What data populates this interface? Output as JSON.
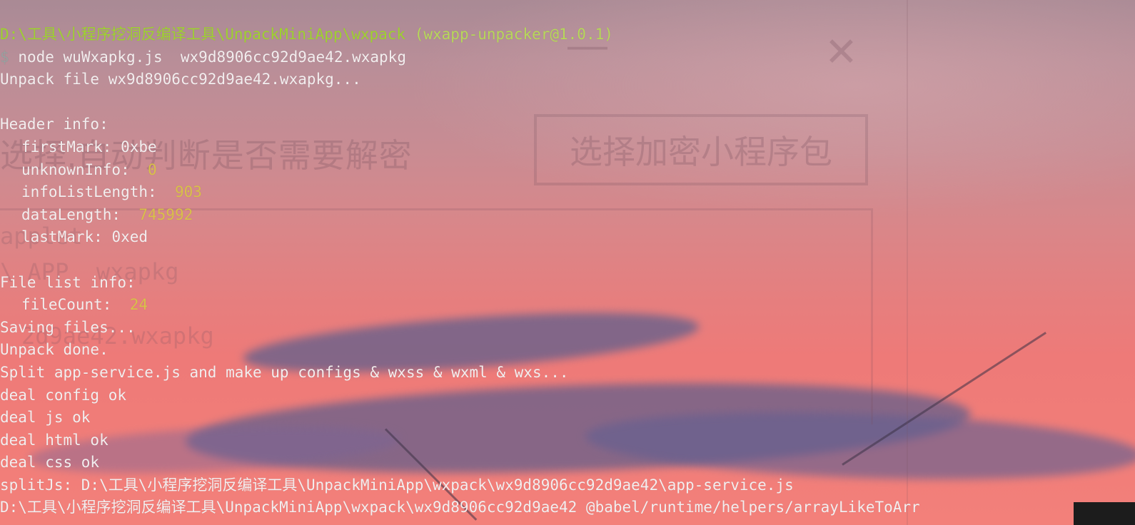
{
  "background_colors": {
    "top": "#a98a95",
    "bottom": "#f3807a",
    "cloud": "#5f5f8c"
  },
  "text_colors": {
    "default": "#f3eeef",
    "prompt_path": "#9fd330",
    "number": "#d9c04a"
  },
  "ghost_window": {
    "label": "选择,自动判断是否需要解密",
    "button": "选择加密小程序包",
    "close_glyph": "✕",
    "minimize_glyph": "—",
    "faint_lines": [
      "applet",
      "\\ APP  wxapkg",
      "2d9ae42.wxapkg"
    ]
  },
  "terminal": {
    "prompt_path": "D:\\工具\\小程序挖洞反编译工具\\UnpackMiniApp\\wxpack",
    "prompt_package": "(wxapp-unpacker@1.0.1)",
    "command_marker": "$",
    "command": "node wuWxapkg.js  wx9d8906cc92d9ae42.wxapkg",
    "unpack_line": "Unpack file wx9d8906cc92d9ae42.wxapkg...",
    "header_title": "Header info:",
    "header": {
      "first_mark_label": "firstMark: ",
      "first_mark_value": "0xbe",
      "unknown_info_label": "unknownInfo:  ",
      "unknown_info_value": "0",
      "info_list_length_label": "infoListLength:  ",
      "info_list_length_value": "903",
      "data_length_label": "dataLength:  ",
      "data_length_value": "745992",
      "last_mark_label": "lastMark: ",
      "last_mark_value": "0xed"
    },
    "file_list_title": "File list info:",
    "file_count_label": "fileCount:  ",
    "file_count_value": "24",
    "saving": "Saving files...",
    "unpack_done": "Unpack done.",
    "split": "Split app-service.js and make up configs & wxss & wxml & wxs...",
    "deal_config": "deal config ok",
    "deal_js": "deal js ok",
    "deal_html": "deal html ok",
    "deal_css": "deal css ok",
    "split_js": "splitJs: D:\\工具\\小程序挖洞反编译工具\\UnpackMiniApp\\wxpack\\wx9d8906cc92d9ae42\\app-service.js",
    "last_line": "D:\\工具\\小程序挖洞反编译工具\\UnpackMiniApp\\wxpack\\wx9d8906cc92d9ae42 @babel/runtime/helpers/arrayLikeToArr"
  }
}
